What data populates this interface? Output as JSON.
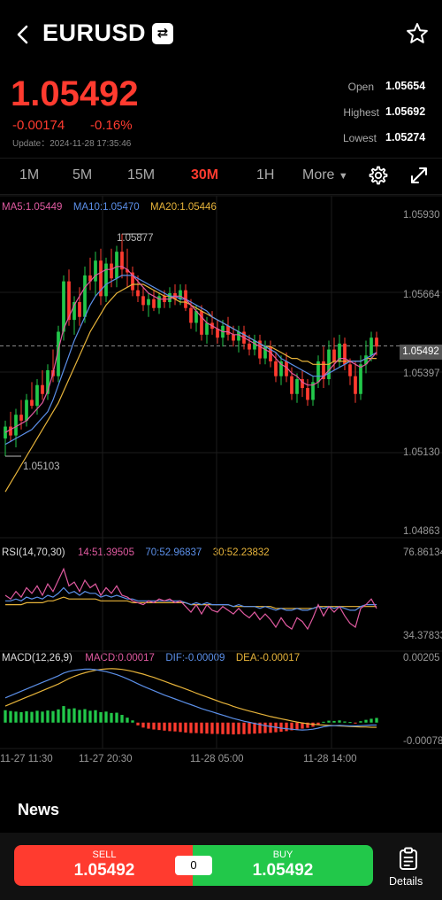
{
  "header": {
    "symbol": "EURUSD",
    "swap_glyph": "⇄"
  },
  "quote": {
    "price": "1.05492",
    "change": "-0.00174",
    "change_pct": "-0.16%",
    "update": "Update：2024-11-28 17:35:46",
    "open_label": "Open",
    "open": "1.05654",
    "high_label": "Highest",
    "high": "1.05692",
    "low_label": "Lowest",
    "low": "1.05274"
  },
  "tabs": [
    "1M",
    "5M",
    "15M",
    "30M",
    "1H",
    "More"
  ],
  "active_tab": "30M",
  "main_legend": {
    "ma5": "MA5:1.05449",
    "ma10": "MA10:1.05470",
    "ma20": "MA20:1.05446"
  },
  "main_axis": [
    "1.05930",
    "1.05664",
    "1.05397",
    "1.05130",
    "1.04863"
  ],
  "current_price_badge": "1.05492",
  "marker_high": "1.05877",
  "marker_low": "1.05103",
  "rsi_legend": {
    "name": "RSI(14,70,30)",
    "r14": "14:51.39505",
    "r70": "70:52.96837",
    "r30": "30:52.23832"
  },
  "rsi_axis": [
    "76.86134",
    "34.37833"
  ],
  "macd_legend": {
    "name": "MACD(12,26,9)",
    "macd": "MACD:0.00017",
    "dif": "DIF:-0.00009",
    "dea": "DEA:-0.00017"
  },
  "macd_axis": [
    "0.00205",
    "-0.00078"
  ],
  "x_axis": [
    "11-27 11:30",
    "11-27 20:30",
    "11-28 05:00",
    "11-28 14:00"
  ],
  "news_title": "News",
  "trade": {
    "sell_label": "SELL",
    "sell_price": "1.05492",
    "spread": "0",
    "buy_label": "BUY",
    "buy_price": "1.05492",
    "details": "Details"
  },
  "colors": {
    "up": "#22c84a",
    "down": "#ff3b2f",
    "ma5": "#e05aa0",
    "ma10": "#5b8fe8",
    "ma20": "#e6b33a"
  },
  "chart_data": {
    "type": "candlestick",
    "timeframe": "30M",
    "y_range": [
      1.04863,
      1.0593
    ],
    "candles": [
      [
        1.0518,
        1.0524,
        1.0512,
        1.0522
      ],
      [
        1.0522,
        1.0527,
        1.0517,
        1.0519
      ],
      [
        1.0519,
        1.0528,
        1.0515,
        1.0526
      ],
      [
        1.0526,
        1.0531,
        1.0521,
        1.0524
      ],
      [
        1.0524,
        1.0533,
        1.0522,
        1.0531
      ],
      [
        1.0531,
        1.0537,
        1.0528,
        1.0529
      ],
      [
        1.0529,
        1.0538,
        1.0526,
        1.0536
      ],
      [
        1.0536,
        1.0541,
        1.0531,
        1.0533
      ],
      [
        1.0533,
        1.0543,
        1.0531,
        1.0541
      ],
      [
        1.0541,
        1.0548,
        1.0537,
        1.0539
      ],
      [
        1.0539,
        1.0556,
        1.0537,
        1.0554
      ],
      [
        1.0554,
        1.0573,
        1.0551,
        1.0571
      ],
      [
        1.0571,
        1.0575,
        1.0556,
        1.0558
      ],
      [
        1.0558,
        1.0566,
        1.0553,
        1.0564
      ],
      [
        1.0564,
        1.0569,
        1.0556,
        1.0559
      ],
      [
        1.0559,
        1.0576,
        1.0557,
        1.0573
      ],
      [
        1.0573,
        1.0579,
        1.0568,
        1.0571
      ],
      [
        1.0571,
        1.0581,
        1.0566,
        1.0578
      ],
      [
        1.0578,
        1.0582,
        1.0563,
        1.0566
      ],
      [
        1.0566,
        1.0579,
        1.0564,
        1.0577
      ],
      [
        1.0577,
        1.0582,
        1.0569,
        1.0572
      ],
      [
        1.0572,
        1.0583,
        1.0569,
        1.0581
      ],
      [
        1.0581,
        1.0587,
        1.0572,
        1.0575
      ],
      [
        1.0575,
        1.0582,
        1.0569,
        1.0574
      ],
      [
        1.0574,
        1.0576,
        1.0566,
        1.0568
      ],
      [
        1.0568,
        1.0573,
        1.0564,
        1.0566
      ],
      [
        1.0566,
        1.0569,
        1.0561,
        1.0563
      ],
      [
        1.0563,
        1.0567,
        1.0559,
        1.0565
      ],
      [
        1.0565,
        1.0568,
        1.0561,
        1.0562
      ],
      [
        1.0562,
        1.0567,
        1.056,
        1.0566
      ],
      [
        1.0566,
        1.0568,
        1.0562,
        1.0564
      ],
      [
        1.0564,
        1.0569,
        1.0562,
        1.0567
      ],
      [
        1.0567,
        1.057,
        1.0563,
        1.0565
      ],
      [
        1.0565,
        1.057,
        1.0563,
        1.0568
      ],
      [
        1.0568,
        1.057,
        1.0561,
        1.0562
      ],
      [
        1.0562,
        1.0565,
        1.0555,
        1.0557
      ],
      [
        1.0557,
        1.0563,
        1.0554,
        1.0561
      ],
      [
        1.0561,
        1.0563,
        1.0551,
        1.0553
      ],
      [
        1.0553,
        1.0559,
        1.055,
        1.0557
      ],
      [
        1.0557,
        1.0561,
        1.0553,
        1.0555
      ],
      [
        1.0555,
        1.0558,
        1.055,
        1.0552
      ],
      [
        1.0552,
        1.0558,
        1.0549,
        1.0556
      ],
      [
        1.0556,
        1.0559,
        1.0551,
        1.0553
      ],
      [
        1.0553,
        1.0556,
        1.0549,
        1.0551
      ],
      [
        1.0551,
        1.0556,
        1.0547,
        1.0554
      ],
      [
        1.0554,
        1.0556,
        1.0548,
        1.055
      ],
      [
        1.055,
        1.0553,
        1.0546,
        1.0548
      ],
      [
        1.0548,
        1.0553,
        1.0546,
        1.0551
      ],
      [
        1.0551,
        1.0553,
        1.0543,
        1.0545
      ],
      [
        1.0545,
        1.0551,
        1.0543,
        1.0549
      ],
      [
        1.0549,
        1.0551,
        1.0542,
        1.0544
      ],
      [
        1.0544,
        1.0547,
        1.0537,
        1.0539
      ],
      [
        1.0539,
        1.0546,
        1.0536,
        1.0544
      ],
      [
        1.0544,
        1.0547,
        1.0537,
        1.0539
      ],
      [
        1.0539,
        1.0542,
        1.0531,
        1.0533
      ],
      [
        1.0533,
        1.054,
        1.053,
        1.0538
      ],
      [
        1.0538,
        1.0541,
        1.0532,
        1.0535
      ],
      [
        1.0535,
        1.0538,
        1.0529,
        1.0531
      ],
      [
        1.0531,
        1.0539,
        1.0529,
        1.0537
      ],
      [
        1.0537,
        1.0546,
        1.0535,
        1.0544
      ],
      [
        1.0544,
        1.0549,
        1.0535,
        1.0538
      ],
      [
        1.0538,
        1.0551,
        1.0536,
        1.0548
      ],
      [
        1.0548,
        1.0552,
        1.0541,
        1.0544
      ],
      [
        1.0544,
        1.0553,
        1.0542,
        1.055
      ],
      [
        1.055,
        1.0552,
        1.0541,
        1.0543
      ],
      [
        1.0543,
        1.0545,
        1.0536,
        1.0539
      ],
      [
        1.0539,
        1.0544,
        1.053,
        1.0533
      ],
      [
        1.0533,
        1.0546,
        1.0531,
        1.0543
      ],
      [
        1.0543,
        1.0551,
        1.054,
        1.0546
      ],
      [
        1.0546,
        1.0554,
        1.0544,
        1.0552
      ],
      [
        1.0552,
        1.0554,
        1.0546,
        1.0549
      ]
    ],
    "ma5": [
      1.052,
      1.0521,
      1.0522,
      1.0523,
      1.0524,
      1.0526,
      1.0528,
      1.053,
      1.0534,
      1.054,
      1.0548,
      1.0555,
      1.0559,
      1.0563,
      1.0566,
      1.0569,
      1.0571,
      1.0573,
      1.0574,
      1.0575,
      1.0575,
      1.0576,
      1.0576,
      1.0575,
      1.0573,
      1.0571,
      1.0569,
      1.0567,
      1.0566,
      1.0565,
      1.0565,
      1.0565,
      1.0566,
      1.0566,
      1.0565,
      1.0563,
      1.0561,
      1.0559,
      1.0557,
      1.0556,
      1.0555,
      1.0554,
      1.0554,
      1.0553,
      1.0553,
      1.0552,
      1.0551,
      1.055,
      1.0549,
      1.0548,
      1.0547,
      1.0545,
      1.0543,
      1.0542,
      1.054,
      1.0539,
      1.0537,
      1.0536,
      1.0536,
      1.0537,
      1.0539,
      1.0541,
      1.0543,
      1.0545,
      1.0545,
      1.0544,
      1.0543,
      1.0542,
      1.0543,
      1.0545,
      1.0547
    ],
    "ma10": [
      1.0516,
      1.0517,
      1.0518,
      1.0519,
      1.052,
      1.0521,
      1.0523,
      1.0525,
      1.0527,
      1.0531,
      1.0536,
      1.0541,
      1.0546,
      1.0551,
      1.0555,
      1.0559,
      1.0563,
      1.0566,
      1.0568,
      1.057,
      1.0571,
      1.0572,
      1.0573,
      1.0573,
      1.0573,
      1.0572,
      1.0571,
      1.057,
      1.0569,
      1.0568,
      1.0567,
      1.0566,
      1.0566,
      1.0565,
      1.0565,
      1.0564,
      1.0563,
      1.0562,
      1.0561,
      1.0559,
      1.0558,
      1.0557,
      1.0556,
      1.0555,
      1.0554,
      1.0553,
      1.0552,
      1.0551,
      1.055,
      1.0549,
      1.0548,
      1.0547,
      1.0545,
      1.0544,
      1.0543,
      1.0542,
      1.0541,
      1.054,
      1.0539,
      1.0539,
      1.0539,
      1.054,
      1.0541,
      1.0542,
      1.0543,
      1.0544,
      1.0544,
      1.0544,
      1.0545,
      1.0546,
      1.0547
    ],
    "ma20": [
      1.05,
      1.0503,
      1.0506,
      1.0509,
      1.0512,
      1.0515,
      1.0518,
      1.0521,
      1.0524,
      1.0527,
      1.053,
      1.0534,
      1.0538,
      1.0542,
      1.0546,
      1.055,
      1.0554,
      1.0557,
      1.056,
      1.0563,
      1.0565,
      1.0567,
      1.0568,
      1.0569,
      1.057,
      1.057,
      1.057,
      1.0569,
      1.0568,
      1.0567,
      1.0566,
      1.0566,
      1.0565,
      1.0564,
      1.0564,
      1.0563,
      1.0562,
      1.0561,
      1.056,
      1.0559,
      1.0558,
      1.0557,
      1.0556,
      1.0555,
      1.0554,
      1.0553,
      1.0552,
      1.0551,
      1.055,
      1.0549,
      1.0549,
      1.0548,
      1.0547,
      1.0546,
      1.0545,
      1.0545,
      1.0544,
      1.0544,
      1.0543,
      1.0543,
      1.0543,
      1.0543,
      1.0544,
      1.0544,
      1.0544,
      1.0544,
      1.0544,
      1.0544,
      1.0545,
      1.0545,
      1.0545
    ],
    "rsi_range": [
      34.37833,
      76.86134
    ],
    "rsi14": [
      58,
      56,
      60,
      57,
      62,
      59,
      63,
      58,
      64,
      60,
      66,
      72,
      63,
      65,
      60,
      66,
      62,
      64,
      58,
      62,
      59,
      63,
      58,
      57,
      55,
      54,
      53,
      55,
      54,
      56,
      55,
      56,
      54,
      55,
      52,
      49,
      53,
      48,
      53,
      50,
      49,
      52,
      50,
      48,
      51,
      48,
      46,
      49,
      45,
      48,
      45,
      41,
      46,
      42,
      40,
      46,
      44,
      40,
      46,
      53,
      47,
      52,
      49,
      52,
      47,
      43,
      41,
      51,
      53,
      56,
      51
    ],
    "rsi70": [
      55,
      55,
      56,
      55,
      57,
      56,
      57,
      56,
      58,
      57,
      59,
      62,
      59,
      60,
      58,
      60,
      59,
      59,
      57,
      58,
      57,
      58,
      57,
      56,
      56,
      55,
      55,
      55,
      55,
      55,
      55,
      55,
      55,
      55,
      54,
      53,
      54,
      53,
      54,
      53,
      53,
      53,
      53,
      52,
      53,
      52,
      52,
      52,
      51,
      52,
      51,
      50,
      51,
      50,
      50,
      51,
      50,
      50,
      51,
      52,
      51,
      52,
      51,
      52,
      51,
      50,
      50,
      52,
      53,
      53,
      53
    ],
    "rsi30": [
      53,
      53,
      53,
      53,
      54,
      54,
      54,
      54,
      55,
      55,
      56,
      57,
      56,
      56,
      56,
      56,
      56,
      56,
      55,
      55,
      55,
      55,
      55,
      55,
      54,
      54,
      54,
      54,
      54,
      54,
      54,
      54,
      54,
      54,
      54,
      53,
      53,
      53,
      53,
      53,
      53,
      53,
      53,
      52,
      52,
      52,
      52,
      52,
      52,
      52,
      52,
      51,
      51,
      51,
      51,
      51,
      51,
      51,
      51,
      52,
      52,
      52,
      52,
      52,
      52,
      52,
      52,
      52,
      52,
      52,
      52
    ],
    "macd_range": [
      -0.00078,
      0.00205
    ],
    "macd_hist": [
      0.00045,
      0.00042,
      0.0004,
      0.00038,
      0.00041,
      0.00039,
      0.00043,
      0.0004,
      0.00044,
      0.00042,
      0.00048,
      0.0006,
      0.0005,
      0.00052,
      0.00046,
      0.00049,
      0.00043,
      0.00045,
      0.00038,
      0.0004,
      0.00035,
      0.00036,
      0.00028,
      0.00018,
      8e-05,
      -0.0001,
      -0.00018,
      -0.00022,
      -0.00025,
      -0.00027,
      -0.00029,
      -0.00031,
      -0.00032,
      -0.00034,
      -0.00036,
      -0.00038,
      -0.00038,
      -0.00039,
      -0.0004,
      -0.00041,
      -0.00041,
      -0.00042,
      -0.00042,
      -0.00043,
      -0.00042,
      -0.00042,
      -0.00041,
      -0.0004,
      -0.00039,
      -0.00038,
      -0.00037,
      -0.00035,
      -0.00033,
      -0.00031,
      -0.00028,
      -0.00025,
      -0.00022,
      -0.00019,
      -0.00015,
      -8e-05,
      3e-05,
      7e-05,
      6e-05,
      8e-05,
      4e-05,
      2e-05,
      -2e-05,
      5e-05,
      0.0001,
      0.00014,
      0.00017
    ],
    "dif": [
      0.0009,
      0.00098,
      0.00106,
      0.00114,
      0.00122,
      0.0013,
      0.00138,
      0.00146,
      0.00154,
      0.00162,
      0.0017,
      0.0018,
      0.00186,
      0.0019,
      0.00192,
      0.00194,
      0.00194,
      0.00192,
      0.00189,
      0.00185,
      0.0018,
      0.00174,
      0.00167,
      0.00159,
      0.0015,
      0.00141,
      0.00132,
      0.00124,
      0.00116,
      0.00108,
      0.001,
      0.00093,
      0.00086,
      0.00079,
      0.00072,
      0.00065,
      0.00058,
      0.00051,
      0.00045,
      0.00039,
      0.00033,
      0.00027,
      0.00021,
      0.00015,
      0.0001,
      5e-05,
      1e-05,
      -3e-05,
      -7e-05,
      -0.00011,
      -0.00014,
      -0.00017,
      -0.0002,
      -0.00022,
      -0.00024,
      -0.00026,
      -0.00027,
      -0.00026,
      -0.00024,
      -0.0002,
      -0.00015,
      -0.00012,
      -0.00011,
      -0.0001,
      -0.00011,
      -0.00012,
      -0.00012,
      -0.00011,
      -0.0001,
      -9e-05,
      -9e-05
    ],
    "dea": [
      0.0006,
      0.00068,
      0.00076,
      0.00084,
      0.00092,
      0.001,
      0.00108,
      0.00116,
      0.00124,
      0.00132,
      0.0014,
      0.0015,
      0.0016,
      0.00168,
      0.00175,
      0.00181,
      0.00186,
      0.0019,
      0.00193,
      0.00195,
      0.00196,
      0.00195,
      0.00193,
      0.0019,
      0.00186,
      0.00181,
      0.00176,
      0.0017,
      0.00164,
      0.00157,
      0.0015,
      0.00143,
      0.00136,
      0.00129,
      0.00122,
      0.00115,
      0.00107,
      0.001,
      0.00093,
      0.00086,
      0.00079,
      0.00072,
      0.00066,
      0.00059,
      0.00053,
      0.00047,
      0.00042,
      0.00037,
      0.00032,
      0.00027,
      0.00022,
      0.00018,
      0.00014,
      0.0001,
      6e-05,
      2e-05,
      -1e-05,
      -4e-05,
      -6e-05,
      -8e-05,
      -9e-05,
      -0.0001,
      -0.00011,
      -0.00012,
      -0.00013,
      -0.00014,
      -0.00015,
      -0.00016,
      -0.00016,
      -0.00017,
      -0.00017
    ]
  }
}
